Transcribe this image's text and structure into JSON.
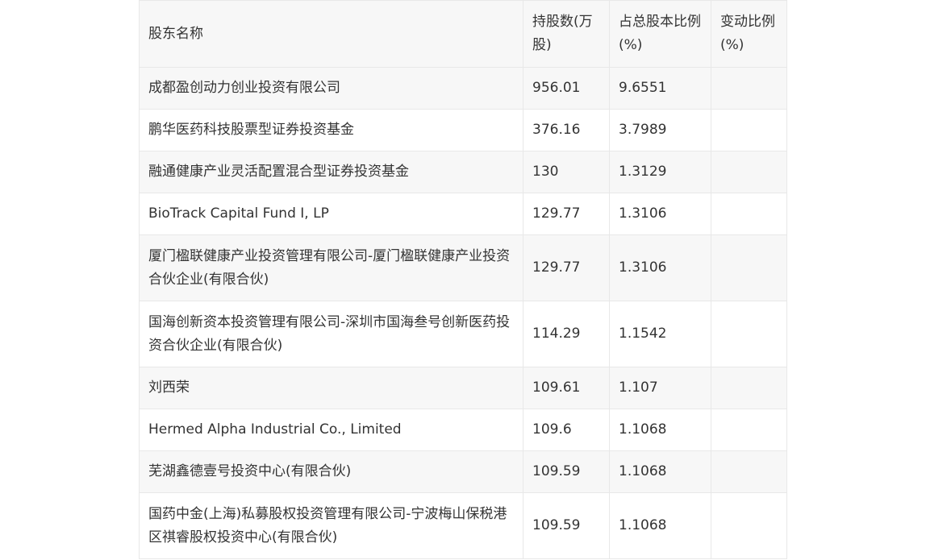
{
  "table": {
    "headers": [
      "股东名称",
      "持股数(万股)",
      "占总股本比例(%)",
      "变动比例(%)"
    ],
    "rows": [
      {
        "name": "成都盈创动力创业投资有限公司",
        "shares": "956.01",
        "ratio": "9.6551",
        "change": ""
      },
      {
        "name": "鹏华医药科技股票型证券投资基金",
        "shares": "376.16",
        "ratio": "3.7989",
        "change": ""
      },
      {
        "name": "融通健康产业灵活配置混合型证券投资基金",
        "shares": "130",
        "ratio": "1.3129",
        "change": ""
      },
      {
        "name": "BioTrack Capital Fund I, LP",
        "shares": "129.77",
        "ratio": "1.3106",
        "change": ""
      },
      {
        "name": "厦门楹联健康产业投资管理有限公司-厦门楹联健康产业投资合伙企业(有限合伙)",
        "shares": "129.77",
        "ratio": "1.3106",
        "change": ""
      },
      {
        "name": "国海创新资本投资管理有限公司-深圳市国海叁号创新医药投资合伙企业(有限合伙)",
        "shares": "114.29",
        "ratio": "1.1542",
        "change": ""
      },
      {
        "name": "刘西荣",
        "shares": "109.61",
        "ratio": "1.107",
        "change": ""
      },
      {
        "name": "Hermed Alpha Industrial Co., Limited",
        "shares": "109.6",
        "ratio": "1.1068",
        "change": ""
      },
      {
        "name": "芜湖鑫德壹号投资中心(有限合伙)",
        "shares": "109.59",
        "ratio": "1.1068",
        "change": ""
      },
      {
        "name": "国药中金(上海)私募股权投资管理有限公司-宁波梅山保税港区祺睿股权投资中心(有限合伙)",
        "shares": "109.59",
        "ratio": "1.1068",
        "change": ""
      }
    ]
  }
}
